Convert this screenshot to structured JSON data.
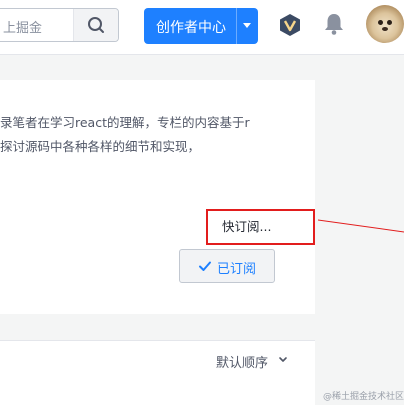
{
  "header": {
    "search_placeholder": "上掘金",
    "creator_button_label": "创作者中心",
    "icons": {
      "search": "search-icon",
      "vip": "vip-badge-icon",
      "notification": "bell-icon",
      "avatar": "user-avatar"
    }
  },
  "column": {
    "description_line1": "录笔者在学习react的理解，专栏的内容基于r",
    "description_line2": "探讨源码中各种各样的细节和实现，",
    "more_link": "快订阅...",
    "subscribed_label": "已订阅"
  },
  "list": {
    "sort_label": "默认顺序"
  },
  "watermark": "@稀土掘金技术社区",
  "colors": {
    "accent": "#1e80ff",
    "highlight_border": "#e21d1d",
    "page_background": "#f4f5f5"
  }
}
